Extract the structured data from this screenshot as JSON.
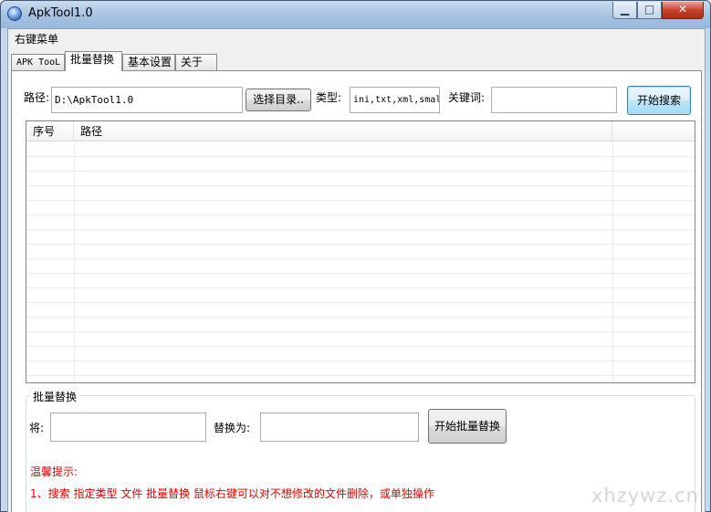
{
  "window": {
    "title": "ApkTool1.0",
    "controls": {
      "minimize": "▁",
      "maximize": "□",
      "close": "✕"
    }
  },
  "menubar": {
    "items": [
      {
        "label": "右键菜单"
      }
    ]
  },
  "tabs": [
    {
      "label": "APK ToоL",
      "active": false
    },
    {
      "label": "批量替换",
      "active": true
    },
    {
      "label": "基本设置",
      "active": false
    },
    {
      "label": "关于",
      "active": false
    }
  ],
  "search": {
    "path_label": "路径:",
    "path_value": "D:\\ApkTool1.0",
    "browse_button": "选择目录..",
    "type_label": "类型:",
    "type_value": "ini,txt,xml,smal",
    "keyword_label": "关键词:",
    "keyword_value": "",
    "search_button": "开始搜索"
  },
  "results_table": {
    "columns": [
      "序号",
      "路径",
      ""
    ],
    "rows": []
  },
  "replace": {
    "group_title": "批量替换",
    "from_label": "将:",
    "from_value": "",
    "to_label": "替换为:",
    "to_value": "",
    "start_button": "开始批量替换"
  },
  "hints": {
    "title": "温馨提示:",
    "line1": "1、搜索 指定类型 文件 批量替换 鼠标右键可以对不想修改的文件删除，或单独操作"
  },
  "watermark": "xhzywz.cn",
  "colors": {
    "hint_text": "#e00000",
    "title_bar": "#a6c2e2",
    "close_button": "#c7432e"
  }
}
